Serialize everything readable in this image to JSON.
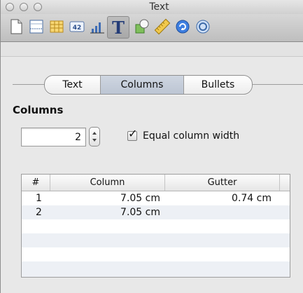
{
  "window": {
    "title": "Text"
  },
  "toolbar": {
    "items": [
      {
        "icon": "document-icon"
      },
      {
        "icon": "layout-icon"
      },
      {
        "icon": "table-icon"
      },
      {
        "icon": "number-format-icon",
        "text": "42"
      },
      {
        "icon": "chart-icon"
      },
      {
        "icon": "text-icon",
        "text": "T",
        "selected": true
      },
      {
        "icon": "graphic-icon"
      },
      {
        "icon": "metrics-icon"
      },
      {
        "icon": "hyperlink-icon"
      },
      {
        "icon": "quicktime-icon"
      }
    ]
  },
  "tabs": [
    {
      "label": "Text",
      "active": false
    },
    {
      "label": "Columns",
      "active": true
    },
    {
      "label": "Bullets",
      "active": false
    }
  ],
  "columns_section": {
    "title": "Columns",
    "count": "2",
    "equal_width_label": "Equal column width",
    "equal_width_checked": true
  },
  "table": {
    "headers": [
      "#",
      "Column",
      "Gutter"
    ],
    "rows": [
      {
        "num": "1",
        "column": "7.05 cm",
        "gutter": "0.74 cm"
      },
      {
        "num": "2",
        "column": "7.05 cm",
        "gutter": ""
      }
    ]
  },
  "colors": {
    "selected_tab": "#c5cdd9",
    "alt_row": "#edf0f5"
  }
}
